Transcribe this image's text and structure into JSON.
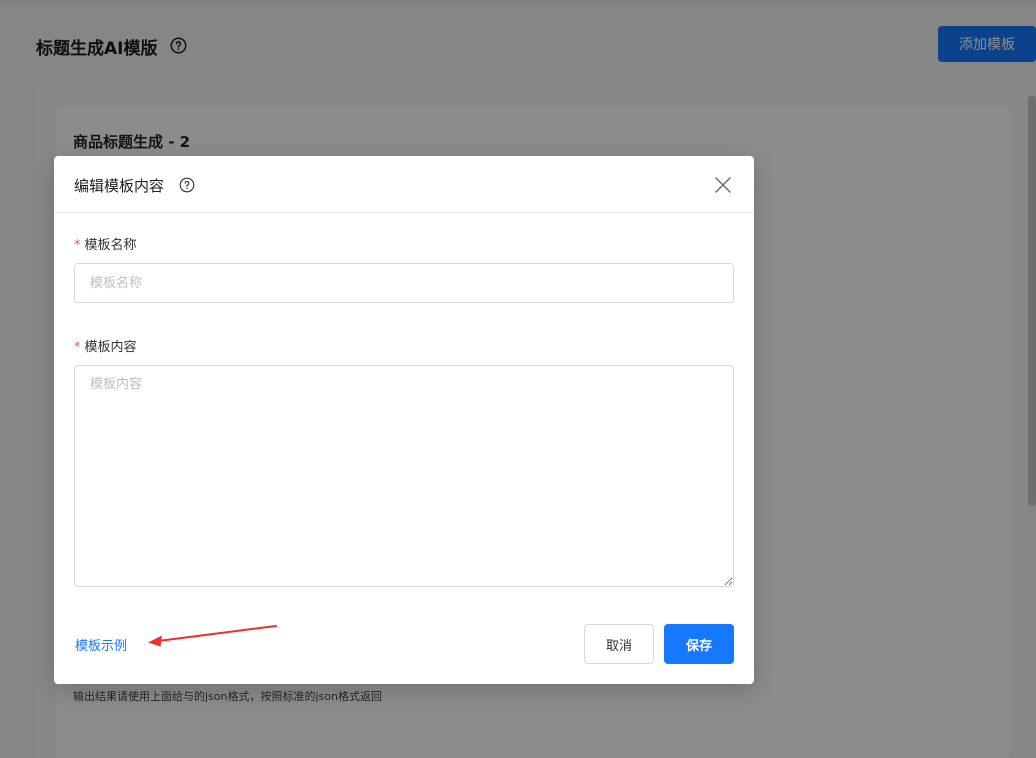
{
  "page": {
    "title": "标题生成AI模版",
    "add_button": "添加模板",
    "card_title": "商品标题生成 - 2",
    "card_note": "输出结果请使用上面给与的json格式，按照标准的json格式返回"
  },
  "modal": {
    "title": "编辑模板内容",
    "name_field": {
      "required_mark": "*",
      "label": "模板名称",
      "placeholder": "模板名称",
      "value": ""
    },
    "content_field": {
      "required_mark": "*",
      "label": "模板内容",
      "placeholder": "模板内容",
      "value": ""
    },
    "example_link": "模板示例",
    "cancel_button": "取消",
    "save_button": "保存"
  },
  "colors": {
    "primary": "#1677ff",
    "required": "#ff4d4f",
    "annotation_arrow": "#e8322b"
  },
  "icons": {
    "help": "question-circle-icon",
    "close": "close-icon",
    "annotation": "red-arrow-icon"
  }
}
